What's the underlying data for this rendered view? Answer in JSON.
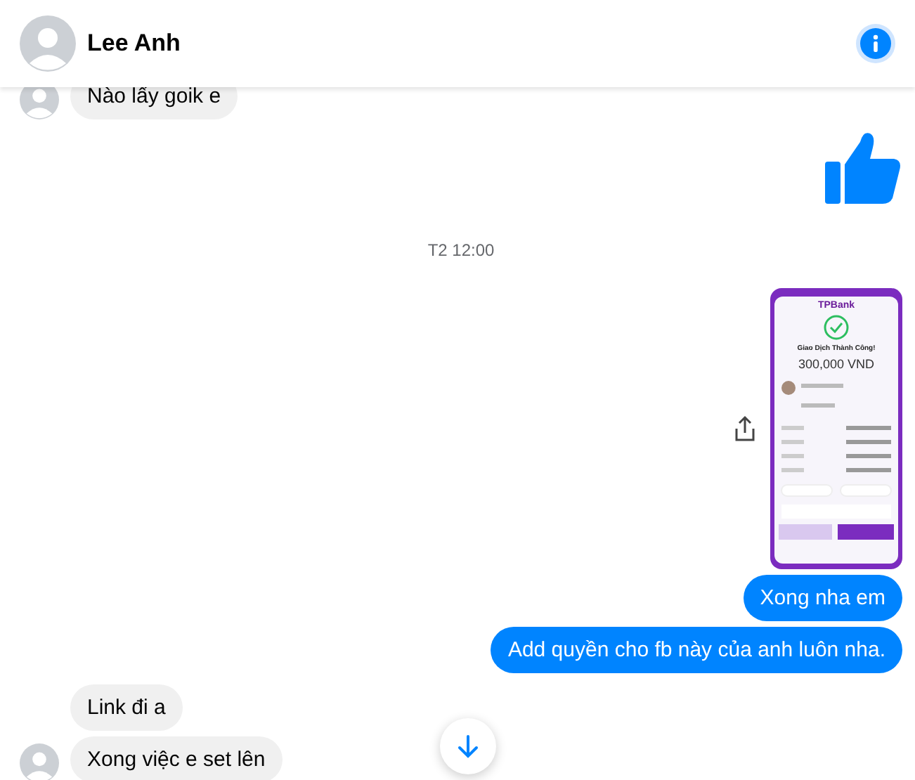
{
  "header": {
    "name": "Lee Anh"
  },
  "messages": [
    {
      "kind": "incoming",
      "text": "Nào lấy goik e",
      "avatar": true
    },
    {
      "kind": "like"
    },
    {
      "kind": "time",
      "text": "T2 12:00"
    },
    {
      "kind": "receipt",
      "bank": "TPBank",
      "title": "Giao Dịch Thành Công!",
      "amount": "300,000 VND"
    },
    {
      "kind": "outgoing",
      "text": "Xong nha em"
    },
    {
      "kind": "outgoing",
      "text": "Add quyền cho fb này của anh luôn nha."
    },
    {
      "kind": "incoming",
      "text": "Link đi a",
      "avatar": false
    },
    {
      "kind": "incoming",
      "text": "Xong việc e set lên",
      "avatar": true
    }
  ]
}
